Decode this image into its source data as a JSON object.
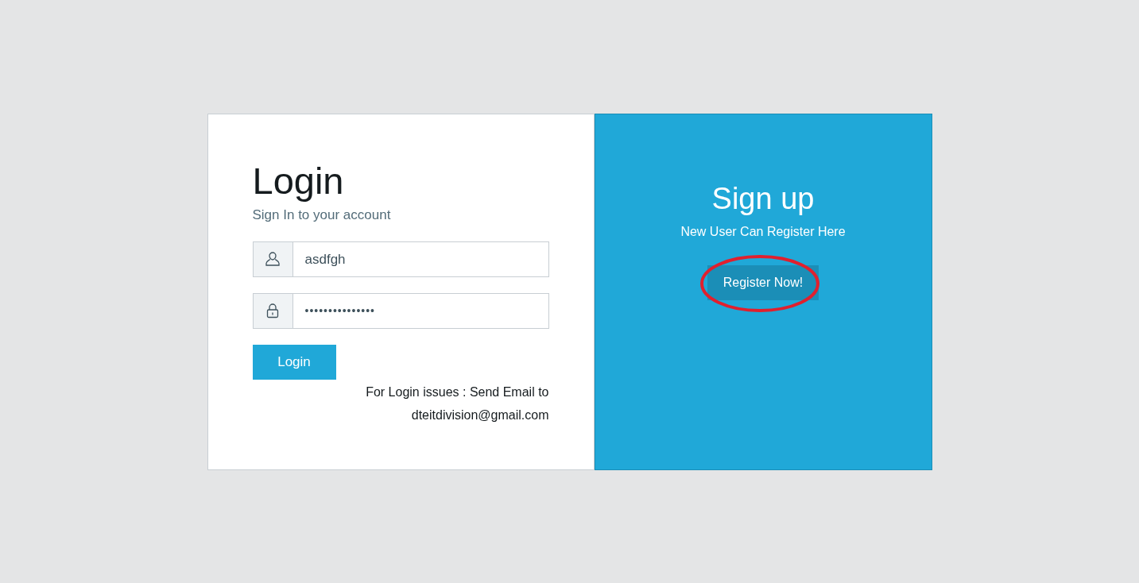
{
  "login": {
    "title": "Login",
    "subtitle": "Sign In to your account",
    "fields": [
      {
        "kind": "user",
        "value": "asdfgh"
      },
      {
        "kind": "password",
        "value": "•••••••••••••••"
      }
    ],
    "button": "Login",
    "help_lines": [
      "For Login issues : Send Email to",
      "dteitdivision@gmail.com"
    ]
  },
  "signup": {
    "title": "Sign up",
    "subtitle": "New User Can Register Here",
    "button": "Register Now!",
    "highlight": {
      "kind": "ellipse",
      "color": "#e0202e"
    }
  }
}
